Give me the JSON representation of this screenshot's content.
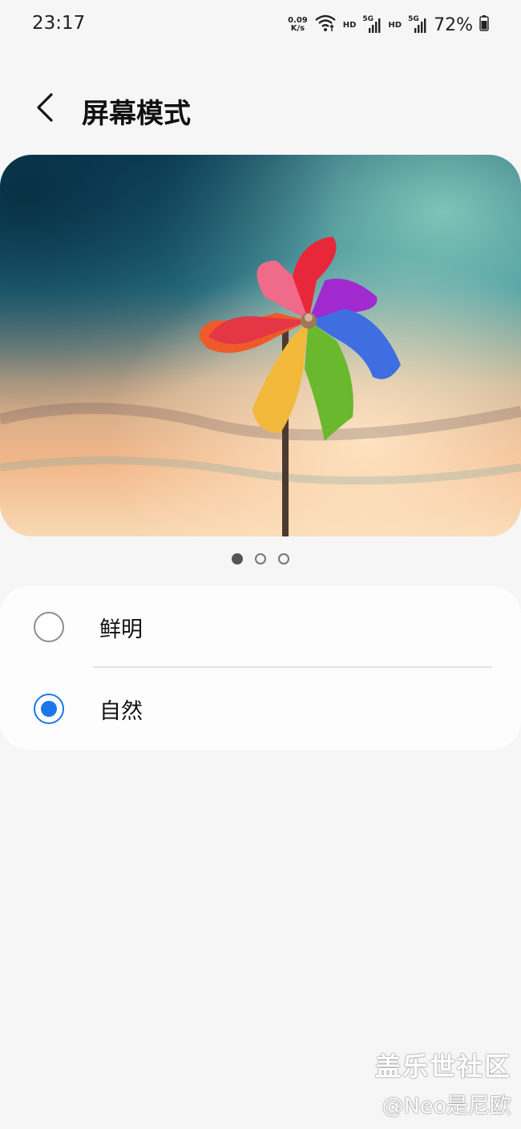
{
  "status_bar": {
    "time": "23:17",
    "net_speed_value": "0.09",
    "net_speed_unit": "K/s",
    "hd1": "HD",
    "sim1": "5G",
    "hd2": "HD",
    "sim2": "5G",
    "battery": "72%"
  },
  "header": {
    "title": "屏幕模式"
  },
  "preview": {
    "page_count": 3,
    "current_page": 1
  },
  "options": [
    {
      "label": "鲜明",
      "selected": false
    },
    {
      "label": "自然",
      "selected": true
    }
  ],
  "colors": {
    "accent": "#1a78e8",
    "background": "#f6f6f6",
    "card": "#fdfdfd"
  },
  "watermark": {
    "line1": "盖乐世社区",
    "line2": "@Neo是尼欧"
  }
}
